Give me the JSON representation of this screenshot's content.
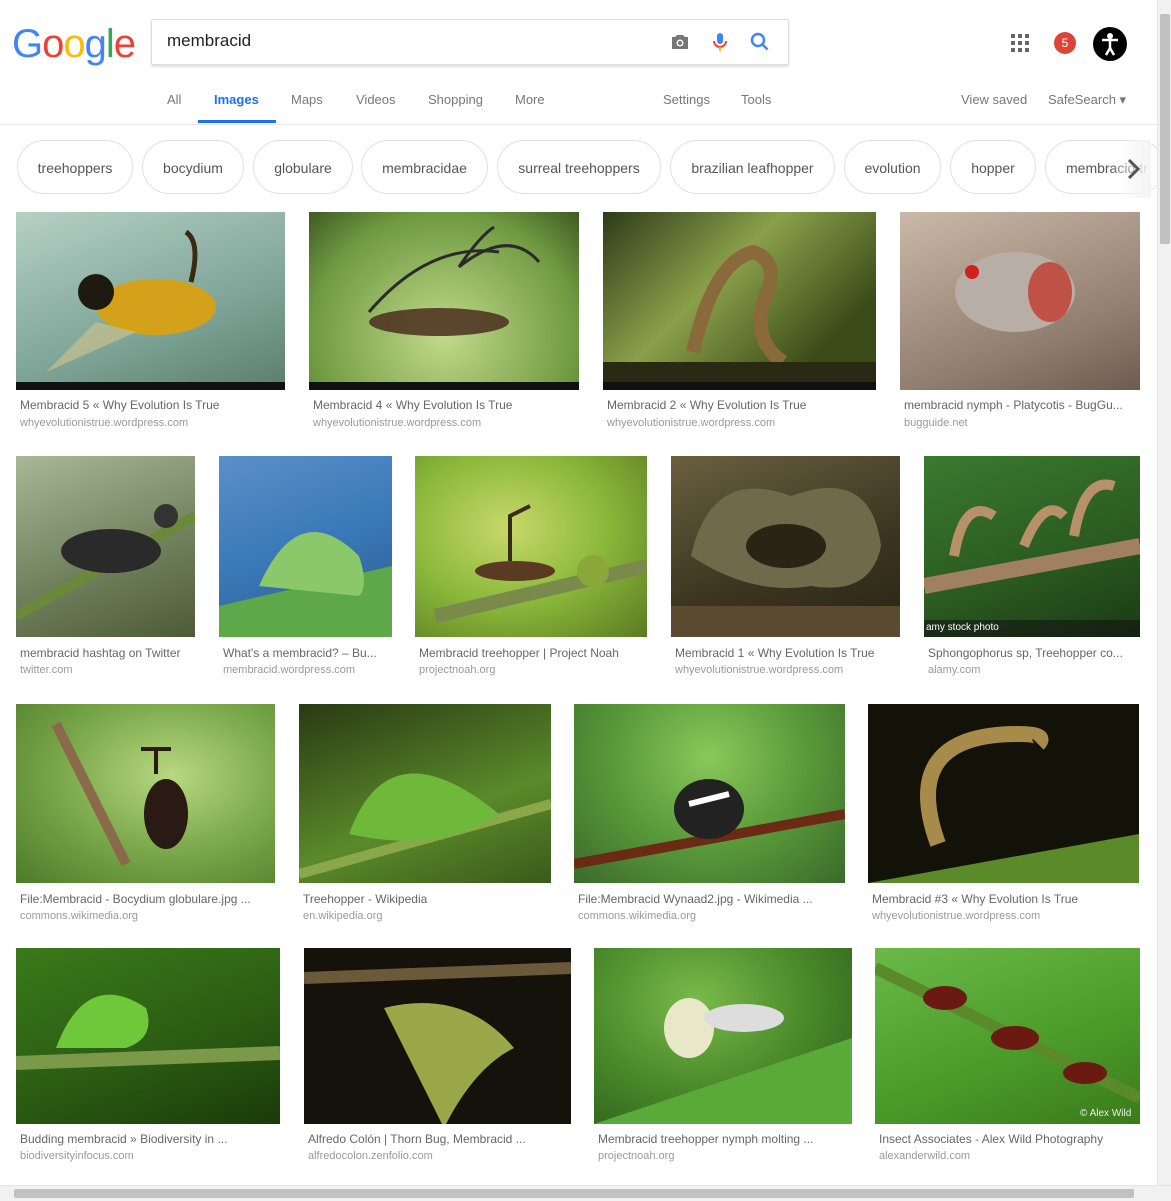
{
  "logo": {
    "letters": [
      "G",
      "o",
      "o",
      "g",
      "l",
      "e"
    ],
    "colors": [
      "#4285f4",
      "#ea4335",
      "#fbbc05",
      "#4285f4",
      "#34a853",
      "#ea4335"
    ]
  },
  "search": {
    "value": "membracid",
    "placeholder": ""
  },
  "notifications": {
    "count": "5"
  },
  "tabs": [
    {
      "label": "All"
    },
    {
      "label": "Images"
    },
    {
      "label": "Maps"
    },
    {
      "label": "Videos"
    },
    {
      "label": "Shopping"
    },
    {
      "label": "More"
    },
    {
      "label": "Settings"
    },
    {
      "label": "Tools"
    },
    {
      "label": "View saved"
    },
    {
      "label": "SafeSearch ▾"
    }
  ],
  "chips": [
    {
      "label": "treehoppers"
    },
    {
      "label": "bocydium"
    },
    {
      "label": "globulare"
    },
    {
      "label": "membracidae"
    },
    {
      "label": "surreal treehoppers"
    },
    {
      "label": "brazilian leafhopper"
    },
    {
      "label": "evolution"
    },
    {
      "label": "hopper"
    },
    {
      "label": "membracid tr"
    }
  ],
  "results": [
    {
      "title": "Membracid 5 « Why Evolution Is True",
      "source": "whyevolutionistrue.wordpress.com",
      "color": "#8fb3a8"
    },
    {
      "title": "Membracid 4 « Why Evolution Is True",
      "source": "whyevolutionistrue.wordpress.com",
      "color": "#7ea85a"
    },
    {
      "title": "Membracid 2 « Why Evolution Is True",
      "source": "whyevolutionistrue.wordpress.com",
      "color": "#4f6a2e"
    },
    {
      "title": "membracid nymph - Platycotis - BugGu...",
      "source": "bugguide.net",
      "color": "#9c8a80"
    },
    {
      "title": "membracid hashtag on Twitter",
      "source": "twitter.com",
      "color": "#5a6e3a"
    },
    {
      "title": "What's a membracid? – Bu...",
      "source": "membracid.wordpress.com",
      "color": "#6da86a"
    },
    {
      "title": "Membracid treehopper | Project Noah",
      "source": "projectnoah.org",
      "color": "#8fb84a"
    },
    {
      "title": "Membracid 1 « Why Evolution Is True",
      "source": "whyevolutionistrue.wordpress.com",
      "color": "#5c5235"
    },
    {
      "title": "Sphongophorus sp, Treehopper co...",
      "source": "alamy.com",
      "color": "#3e6a30"
    },
    {
      "title": "File:Membracid - Bocydium globulare.jpg ...",
      "source": "commons.wikimedia.org",
      "color": "#6f9a3a"
    },
    {
      "title": "Treehopper - Wikipedia",
      "source": "en.wikipedia.org",
      "color": "#4f8a2a"
    },
    {
      "title": "File:Membracid Wynaad2.jpg - Wikimedia ...",
      "source": "commons.wikimedia.org",
      "color": "#5a8a38"
    },
    {
      "title": "Membracid #3 « Why Evolution Is True",
      "source": "whyevolutionistrue.wordpress.com",
      "color": "#1c1c10"
    },
    {
      "title": "Budding membracid » Biodiversity in ...",
      "source": "biodiversityinfocus.com",
      "color": "#3e7a24"
    },
    {
      "title": "Alfredo Colón | Thorn Bug, Membracid ...",
      "source": "alfredocolon.zenfolio.com",
      "color": "#1e1a10"
    },
    {
      "title": "Membracid treehopper nymph molting ...",
      "source": "projectnoah.org",
      "color": "#4c8a2a"
    },
    {
      "title": "Insect Associates - Alex Wild Photography",
      "source": "alexanderwild.com",
      "color": "#5aa83a"
    }
  ],
  "image_overlays": {
    "alamy_watermark": "amy stock photo",
    "alexwild_watermark": "© Alex Wild"
  }
}
